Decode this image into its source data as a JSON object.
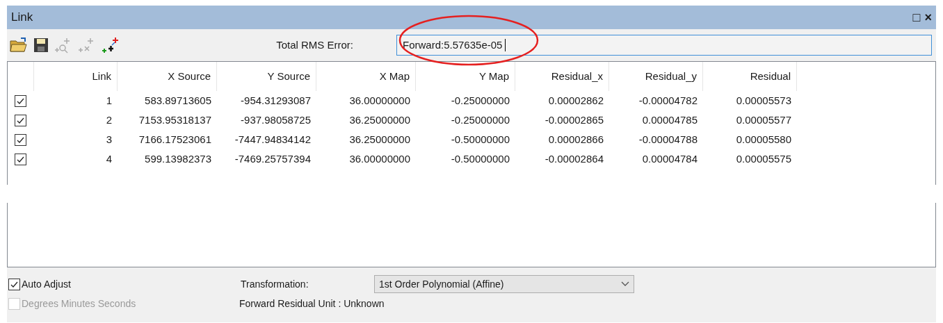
{
  "window": {
    "title": "Link",
    "controls": [
      "□",
      "×"
    ]
  },
  "toolbar": {
    "rms_label": "Total RMS Error:",
    "rms_value": "Forward:5.57635e-05",
    "highlighted": true
  },
  "table": {
    "columns": [
      "Link",
      "X Source",
      "Y Source",
      "X Map",
      "Y Map",
      "Residual_x",
      "Residual_y",
      "Residual"
    ],
    "rows": [
      {
        "checked": true,
        "cells": [
          "1",
          "583.89713605",
          "-954.31293087",
          "36.00000000",
          "-0.25000000",
          "0.00002862",
          "-0.00004782",
          "0.00005573"
        ]
      },
      {
        "checked": true,
        "cells": [
          "2",
          "7153.95318137",
          "-937.98058725",
          "36.25000000",
          "-0.25000000",
          "-0.00002865",
          "0.00004785",
          "0.00005577"
        ]
      },
      {
        "checked": true,
        "cells": [
          "3",
          "7166.17523061",
          "-7447.94834142",
          "36.25000000",
          "-0.50000000",
          "0.00002866",
          "-0.00004788",
          "0.00005580"
        ]
      },
      {
        "checked": true,
        "cells": [
          "4",
          "599.13982373",
          "-7469.25757394",
          "36.00000000",
          "-0.50000000",
          "-0.00002864",
          "0.00004784",
          "0.00005575"
        ]
      }
    ]
  },
  "options": {
    "auto_adjust": {
      "label": "Auto Adjust",
      "checked": true,
      "disabled": false
    },
    "dms": {
      "label": "Degrees Minutes Seconds",
      "checked": false,
      "disabled": true
    },
    "transformation_label": "Transformation:",
    "transformation_value": "1st Order Polynomial (Affine)",
    "residual_unit": "Forward Residual Unit : Unknown"
  }
}
